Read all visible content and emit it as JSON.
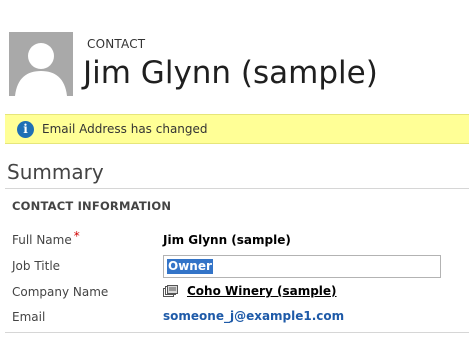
{
  "header": {
    "entity_type": "CONTACT",
    "record_name": "Jim Glynn (sample)",
    "avatar_icon": "person-silhouette-icon"
  },
  "notification": {
    "icon": "info-icon",
    "icon_glyph": "i",
    "text": "Email Address has changed",
    "background_color": "#ffff96"
  },
  "summary": {
    "title": "Summary",
    "group_title": "CONTACT INFORMATION",
    "fields": {
      "full_name": {
        "label": "Full Name",
        "required_marker": "*",
        "value": "Jim Glynn (sample)"
      },
      "job_title": {
        "label": "Job Title",
        "value": "Owner"
      },
      "company_name": {
        "label": "Company Name",
        "value": "Coho Winery (sample)",
        "icon": "account-record-icon"
      },
      "email": {
        "label": "Email",
        "value": "someone_j@example1.com"
      }
    }
  },
  "colors": {
    "link_blue": "#1e5aa8",
    "selection_blue": "#3374c8",
    "required_red": "#d00000"
  }
}
